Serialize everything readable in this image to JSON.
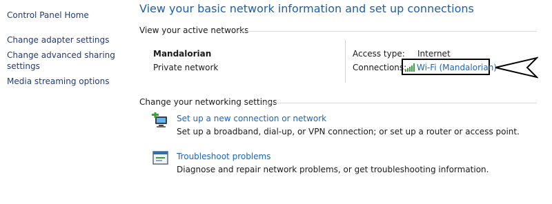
{
  "sidebar": {
    "items": [
      {
        "label": "Control Panel Home"
      },
      {
        "label": "Change adapter settings"
      },
      {
        "label": "Change advanced sharing settings",
        "lines": [
          "Change advanced sharing",
          "settings"
        ]
      },
      {
        "label": "Media streaming options"
      }
    ]
  },
  "main": {
    "title": "View your basic network information and set up connections",
    "active_networks": {
      "heading": "View your active networks",
      "network_name": "Mandalorian",
      "network_category": "Private network",
      "access_type_label": "Access type:",
      "access_type_value": "Internet",
      "connections_label": "Connections:",
      "connection_link": "Wi-Fi (Mandalorian)"
    },
    "settings": {
      "heading": "Change your networking settings",
      "items": [
        {
          "title": "Set up a new connection or network",
          "description": "Set up a broadband, dial-up, or VPN connection; or set up a router or access point.",
          "icon": "new-connection-icon"
        },
        {
          "title": "Troubleshoot problems",
          "description": "Diagnose and repair network problems, or get troubleshooting information.",
          "icon": "troubleshoot-icon"
        }
      ]
    }
  },
  "annotation": {
    "icon": "arrow-pointer-icon"
  },
  "colors": {
    "link": "#1a66b8",
    "title": "#1f5fa3",
    "sidebar_link": "#1f3a78"
  }
}
